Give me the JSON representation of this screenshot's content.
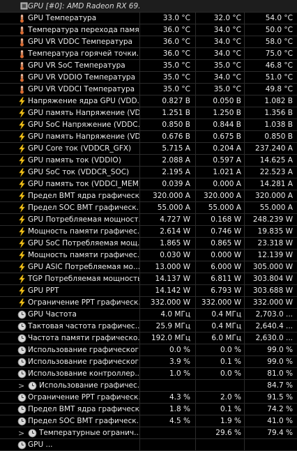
{
  "header": {
    "title": "GPU [#0]: AMD Radeon RX 69...",
    "icon": "gpu-chip-icon"
  },
  "rows": [
    {
      "icon": "temp",
      "label": "GPU Температура",
      "cur": "33.0 °C",
      "min": "32.0 °C",
      "max": "54.0 °C"
    },
    {
      "icon": "temp",
      "label": "Температура перехода памя...",
      "cur": "36.0 °C",
      "min": "34.0 °C",
      "max": "50.0 °C"
    },
    {
      "icon": "temp",
      "label": "GPU VR VDDC Температура",
      "cur": "36.0 °C",
      "min": "34.0 °C",
      "max": "58.0 °C"
    },
    {
      "icon": "temp",
      "label": "Температура горячей точки...",
      "cur": "36.0 °C",
      "min": "34.0 °C",
      "max": "75.0 °C"
    },
    {
      "icon": "temp",
      "label": "GPU VR SoC Температура",
      "cur": "35.0 °C",
      "min": "35.0 °C",
      "max": "46.8 °C"
    },
    {
      "icon": "temp",
      "label": "GPU VR VDDIO Температура",
      "cur": "35.0 °C",
      "min": "34.0 °C",
      "max": "51.0 °C"
    },
    {
      "icon": "temp",
      "label": "GPU VR VDDCI Температура",
      "cur": "35.0 °C",
      "min": "35.0 °C",
      "max": "49.8 °C"
    },
    {
      "icon": "bolt",
      "label": "Напряжение ядра GPU (VDD...",
      "cur": "0.827 В",
      "min": "0.050 В",
      "max": "1.082 В"
    },
    {
      "icon": "bolt",
      "label": "GPU память Напряжение (VD...",
      "cur": "1.251 В",
      "min": "1.250 В",
      "max": "1.356 В"
    },
    {
      "icon": "bolt",
      "label": "GPU SoC Напряжение (VDDC...",
      "cur": "0.850 В",
      "min": "0.844 В",
      "max": "1.038 В"
    },
    {
      "icon": "bolt",
      "label": "GPU память Напряжение (VD...",
      "cur": "0.676 В",
      "min": "0.675 В",
      "max": "0.850 В"
    },
    {
      "icon": "bolt",
      "label": "GPU Core ток (VDDCR_GFX)",
      "cur": "5.715 A",
      "min": "0.204 A",
      "max": "237.240 A"
    },
    {
      "icon": "bolt",
      "label": "GPU память ток (VDDIO)",
      "cur": "2.088 A",
      "min": "0.597 A",
      "max": "14.625 A"
    },
    {
      "icon": "bolt",
      "label": "GPU SoC ток (VDDCR_SOC)",
      "cur": "2.195 A",
      "min": "1.021 A",
      "max": "22.523 A"
    },
    {
      "icon": "bolt",
      "label": "GPU память ток (VDDCI_MEM)",
      "cur": "0.039 A",
      "min": "0.000 A",
      "max": "14.281 A"
    },
    {
      "icon": "bolt",
      "label": "Предел BMT ядра графическ...",
      "cur": "320.000 A",
      "min": "320.000 A",
      "max": "320.000 A"
    },
    {
      "icon": "bolt",
      "label": "Предел SOC BMT графическ...",
      "cur": "55.000 A",
      "min": "55.000 A",
      "max": "55.000 A"
    },
    {
      "icon": "bolt",
      "label": "GPU Потребляемая мощност...",
      "cur": "4.727 W",
      "min": "0.168 W",
      "max": "248.239 W"
    },
    {
      "icon": "bolt",
      "label": "Мощность памяти графичес...",
      "cur": "2.614 W",
      "min": "0.746 W",
      "max": "19.835 W"
    },
    {
      "icon": "bolt",
      "label": "GPU SoC Потребляемая мощ...",
      "cur": "1.865 W",
      "min": "0.865 W",
      "max": "23.318 W"
    },
    {
      "icon": "bolt",
      "label": "Мощность памяти графичес...",
      "cur": "0.030 W",
      "min": "0.000 W",
      "max": "12.139 W"
    },
    {
      "icon": "bolt",
      "label": "GPU ASIC Потребляемая мо...",
      "cur": "13.000 W",
      "min": "6.000 W",
      "max": "305.000 W"
    },
    {
      "icon": "bolt",
      "label": "TGP Потребляемая мощность",
      "cur": "14.137 W",
      "min": "6.811 W",
      "max": "303.804 W"
    },
    {
      "icon": "bolt",
      "label": "GPU PPT",
      "cur": "14.142 W",
      "min": "6.793 W",
      "max": "303.688 W"
    },
    {
      "icon": "bolt",
      "label": "Ограничение PPT графическ...",
      "cur": "332.000 W",
      "min": "332.000 W",
      "max": "332.000 W"
    },
    {
      "icon": "clock",
      "label": "GPU Частота",
      "cur": "4.0 МГц",
      "min": "0.4 МГц",
      "max": "2,703.0 ..."
    },
    {
      "icon": "clock",
      "label": "Тактовая частота графичес...",
      "cur": "25.9 МГц",
      "min": "0.4 МГц",
      "max": "2,640.4 ..."
    },
    {
      "icon": "clock",
      "label": "Частота памяти графическо...",
      "cur": "192.0 МГц",
      "min": "6.0 МГц",
      "max": "2,630.0 ..."
    },
    {
      "icon": "clock",
      "label": "Использование графическог...",
      "cur": "0.0 %",
      "min": "0.0 %",
      "max": "99.0 %"
    },
    {
      "icon": "clock",
      "label": "Использование графическог...",
      "cur": "3.9 %",
      "min": "0.1 %",
      "max": "99.0 %"
    },
    {
      "icon": "clock",
      "label": "Использование контроллер...",
      "cur": "1.0 %",
      "min": "0.0 %",
      "max": "81.0 %"
    },
    {
      "icon": "clock",
      "label": "Использование графичес...",
      "cur": "",
      "min": "",
      "max": "84.7 %",
      "sub": true,
      "expand": ">"
    },
    {
      "icon": "clock",
      "label": "Ограничение PPT графическ...",
      "cur": "4.3 %",
      "min": "2.0 %",
      "max": "91.5 %"
    },
    {
      "icon": "clock",
      "label": "Предел BMT ядра графическ...",
      "cur": "1.8 %",
      "min": "0.1 %",
      "max": "74.2 %"
    },
    {
      "icon": "clock",
      "label": "Предел SOC BMT графическ...",
      "cur": "4.5 %",
      "min": "1.9 %",
      "max": "41.0 %"
    },
    {
      "icon": "clock",
      "label": "Температурные огранич...",
      "cur": "",
      "min": "29.6 %",
      "max": "79.4 %",
      "sub": true,
      "expand": ">"
    },
    {
      "icon": "clock",
      "label": "GPU ...",
      "cur": "",
      "min": "",
      "max": "",
      "expand": ""
    }
  ],
  "colors": {
    "background": "#000000",
    "header": "#1d1d1d",
    "grid": "#2b2b2b",
    "text": "#ececec",
    "thermo": "#e06b2d",
    "bolt": "#f3c41c",
    "clock": "#c8c8c8"
  }
}
